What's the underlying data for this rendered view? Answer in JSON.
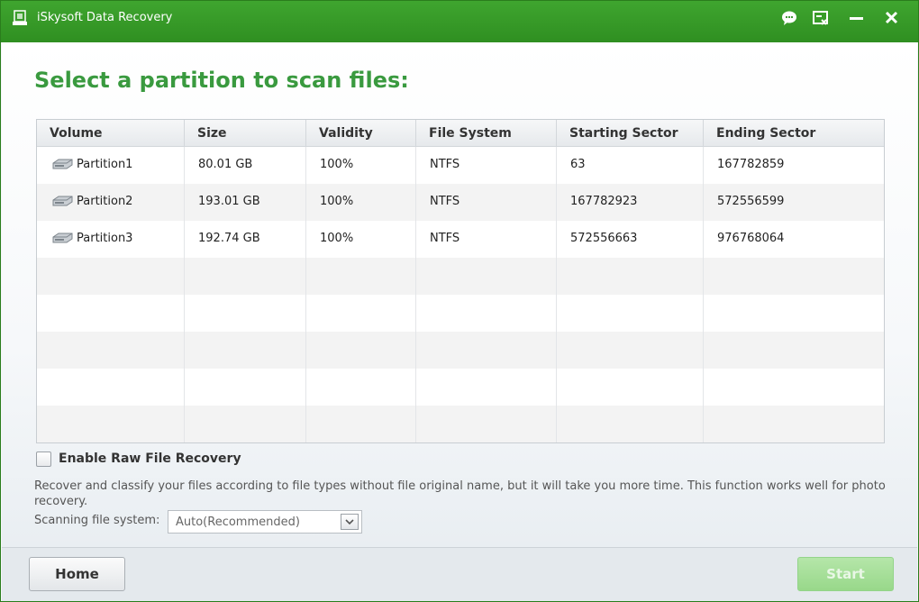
{
  "window": {
    "title": "iSkysoft Data Recovery"
  },
  "main": {
    "heading": "Select a partition to scan files:",
    "table": {
      "columns": [
        "Volume",
        "Size",
        "Validity",
        "File System",
        "Starting Sector",
        "Ending Sector"
      ],
      "rows": [
        {
          "volume": "Partition1",
          "size": "80.01 GB",
          "validity": "100%",
          "fs": "NTFS",
          "start": "63",
          "end": "167782859"
        },
        {
          "volume": "Partition2",
          "size": "193.01 GB",
          "validity": "100%",
          "fs": "NTFS",
          "start": "167782923",
          "end": "572556599"
        },
        {
          "volume": "Partition3",
          "size": "192.74 GB",
          "validity": "100%",
          "fs": "NTFS",
          "start": "572556663",
          "end": "976768064"
        }
      ]
    },
    "raw_recovery": {
      "label": "Enable Raw File Recovery",
      "checked": false,
      "description": "Recover and classify your files according to file types without file original name, but it will take you more time. This function works well for photo recovery."
    },
    "scanning": {
      "label": "Scanning file system:",
      "selected": "Auto(Recommended)"
    }
  },
  "footer": {
    "home_label": "Home",
    "start_label": "Start"
  },
  "colors": {
    "titlebar": "#3a9f2c",
    "heading": "#3a9a3f",
    "start_button": "#a6df99"
  }
}
